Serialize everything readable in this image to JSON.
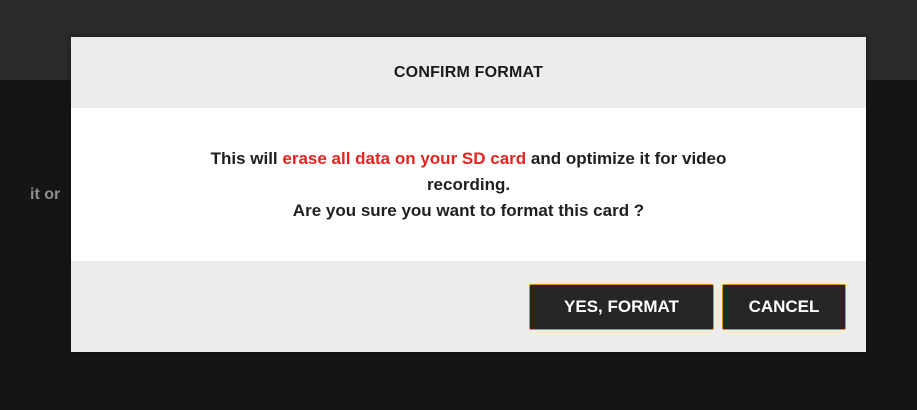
{
  "background": {
    "partial_text": "it or"
  },
  "dialog": {
    "title": "CONFIRM FORMAT",
    "message": {
      "part1": "This will ",
      "highlight": "erase all data on your SD card",
      "part2": " and optimize it for video",
      "line2": "recording.",
      "line3": "Are you sure you want to format this card ?"
    },
    "buttons": {
      "confirm": "YES, FORMAT",
      "cancel": "CANCEL"
    }
  },
  "colors": {
    "highlight": "#e8231f",
    "button_border": "#d58a1a",
    "button_bg": "#262626"
  }
}
